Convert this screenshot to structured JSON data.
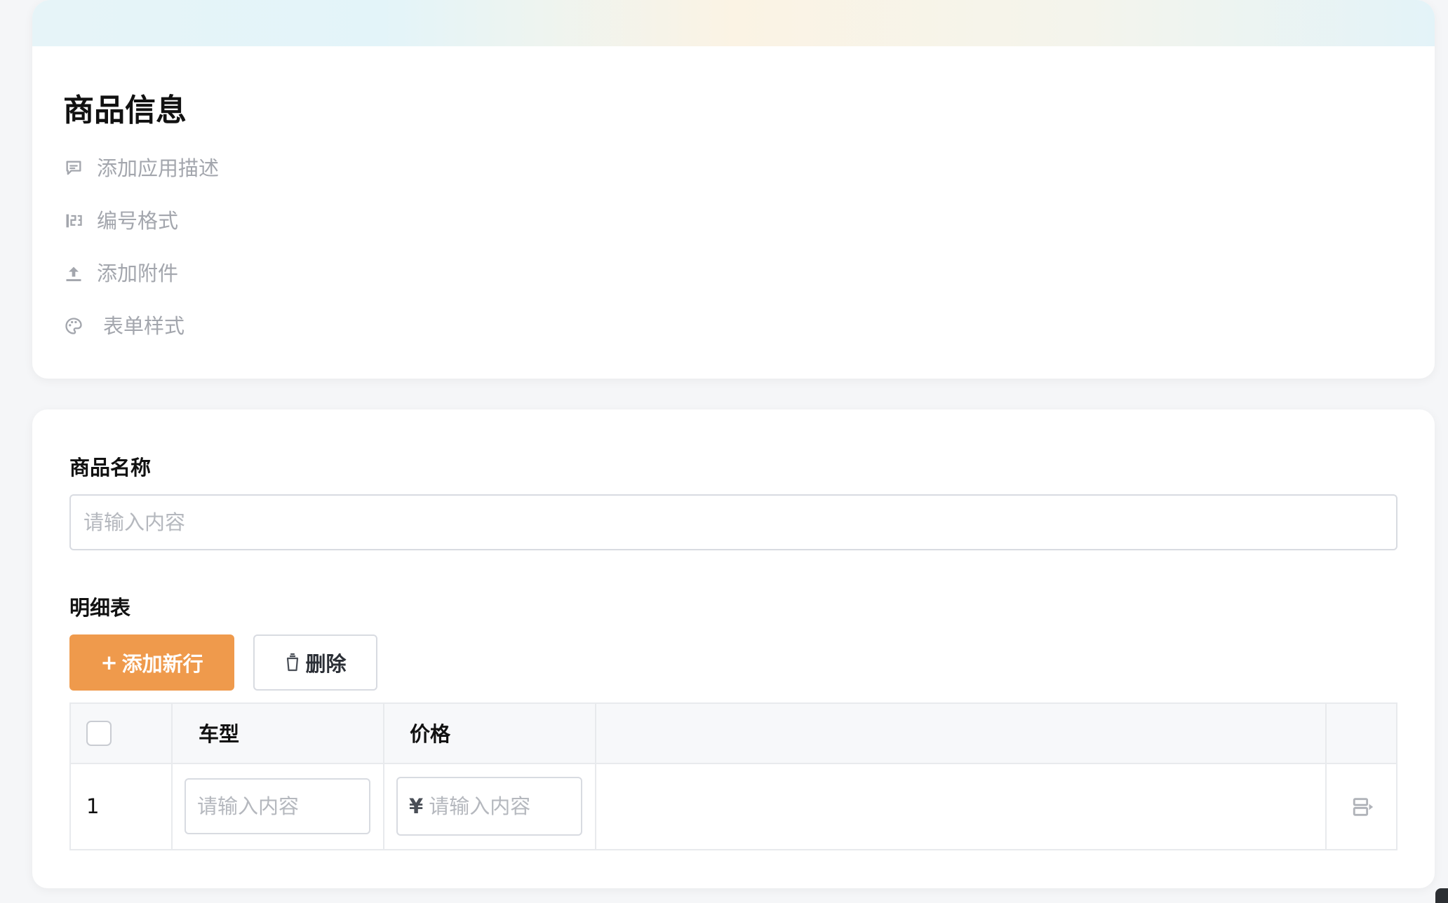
{
  "header": {
    "title": "商品信息",
    "actions": [
      {
        "label": "添加应用描述",
        "icon": "comment-icon"
      },
      {
        "label": "编号格式",
        "icon": "number-format-icon"
      },
      {
        "label": "添加附件",
        "icon": "upload-icon"
      },
      {
        "label": "表单样式",
        "icon": "palette-icon"
      }
    ]
  },
  "form": {
    "product_name": {
      "label": "商品名称",
      "placeholder": "请输入内容",
      "value": ""
    },
    "detail_table": {
      "label": "明细表",
      "add_row_label": "添加新行",
      "add_row_prefix": "+",
      "delete_label": "删除",
      "columns": [
        "车型",
        "价格"
      ],
      "rows": [
        {
          "index": "1",
          "car_type_placeholder": "请输入内容",
          "price_placeholder": "请输入内容",
          "currency": "¥"
        }
      ]
    }
  },
  "colors": {
    "primary": "#ef9a4c",
    "muted_text": "#a3a6ad",
    "border": "#d8dbe1",
    "table_header_bg": "#f7f8fa"
  }
}
